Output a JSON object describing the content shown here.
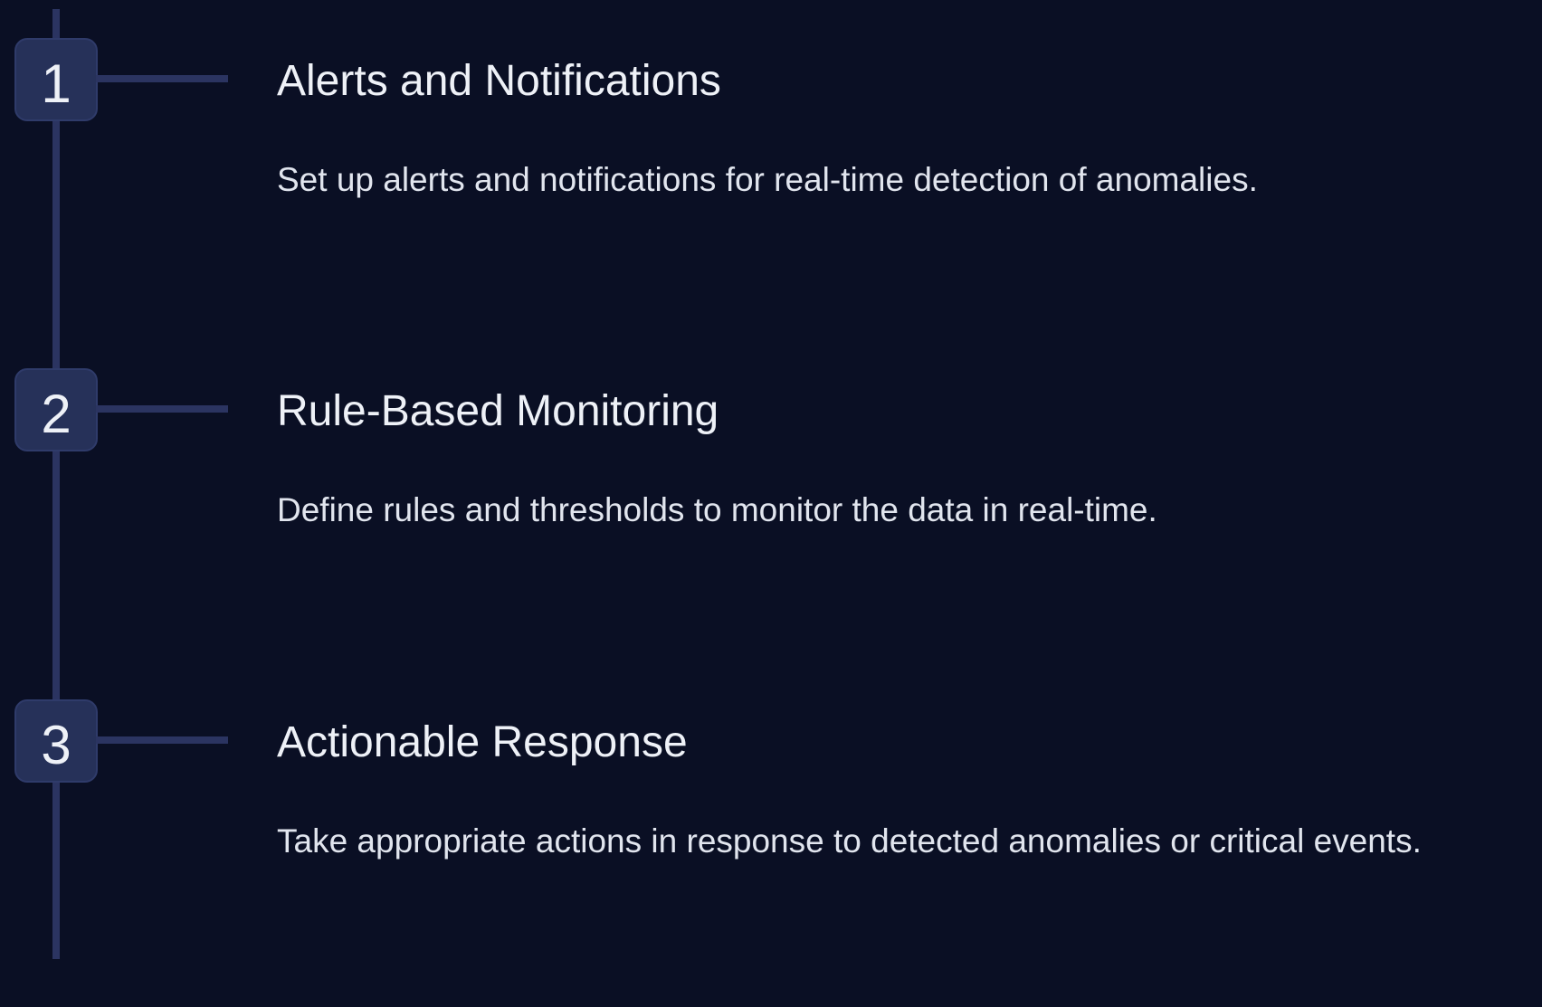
{
  "timeline": {
    "steps": [
      {
        "number": "1",
        "title": "Alerts and Notifications",
        "description": "Set up alerts and notifications for real-time detection of anomalies."
      },
      {
        "number": "2",
        "title": "Rule-Based Monitoring",
        "description": "Define rules and thresholds to monitor the data in real-time."
      },
      {
        "number": "3",
        "title": "Actionable Response",
        "description": "Take appropriate actions in response to detected anomalies or critical events."
      }
    ]
  },
  "colors": {
    "background": "#0a0f24",
    "line": "#2b3461",
    "badge": "#263159",
    "text": "#eef1f7"
  }
}
